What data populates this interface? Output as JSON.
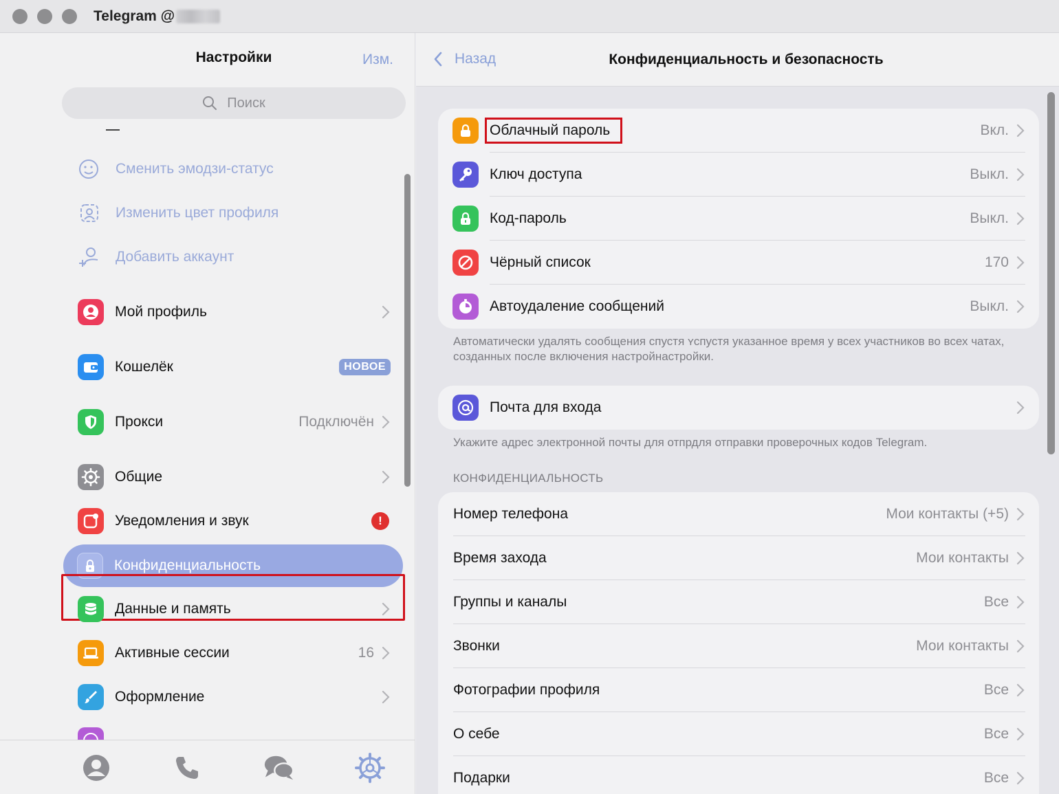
{
  "window": {
    "title": "Telegram @"
  },
  "left": {
    "title": "Настройки",
    "edit": "Изм.",
    "search_placeholder": "Поиск",
    "quick": [
      {
        "label": "Сменить эмодзи-статус",
        "icon": "emoji-status-icon"
      },
      {
        "label": "Изменить цвет профиля",
        "icon": "profile-color-icon"
      },
      {
        "label": "Добавить аккаунт",
        "icon": "add-account-icon"
      }
    ],
    "items": [
      {
        "label": "Мой профиль",
        "icon": "profile-icon",
        "color": "#ec3b5b"
      },
      {
        "label": "Кошелёк",
        "icon": "wallet-icon",
        "color": "#2a8ef0",
        "badge": "НОВОЕ"
      },
      {
        "label": "Прокси",
        "icon": "shield-icon",
        "color": "#35c35b",
        "value": "Подключён"
      },
      {
        "label": "Общие",
        "icon": "gear-icon",
        "color": "#8e8e93"
      },
      {
        "label": "Уведомления и звук",
        "icon": "bell-icon",
        "color": "#f04343",
        "alert": "!"
      },
      {
        "label": "Конфиденциальность",
        "icon": "lock-icon",
        "color": "#a9b7ea"
      },
      {
        "label": "Данные и память",
        "icon": "database-icon",
        "color": "#35c35b"
      },
      {
        "label": "Активные сессии",
        "icon": "laptop-icon",
        "color": "#f59a0c",
        "value": "16"
      },
      {
        "label": "Оформление",
        "icon": "brush-icon",
        "color": "#33a3e0"
      }
    ],
    "tabs": [
      "contacts-tab",
      "calls-tab",
      "chats-tab",
      "settings-tab"
    ]
  },
  "right": {
    "back": "Назад",
    "title": "Конфиденциальность и безопасность",
    "security": [
      {
        "label": "Облачный пароль",
        "value": "Вкл.",
        "icon": "cloud-lock-icon",
        "color": "#f59a0c"
      },
      {
        "label": "Ключ доступа",
        "value": "Выкл.",
        "icon": "key-icon",
        "color": "#5b58d9"
      },
      {
        "label": "Код-пароль",
        "value": "Выкл.",
        "icon": "passcode-lock-icon",
        "color": "#35c35b"
      },
      {
        "label": "Чёрный список",
        "value": "170",
        "icon": "blocked-icon",
        "color": "#f04343"
      },
      {
        "label": "Автоудаление сообщений",
        "value": "Выкл.",
        "icon": "timer-icon",
        "color": "#b35bd6"
      }
    ],
    "autodelete_note": "Автоматически удалять сообщения спустя ʏспустя указанное время у всех участников во всех чатах, созданных после включения настройнастройки.",
    "email": {
      "label": "Почта для входа",
      "icon": "at-icon",
      "color": "#5b58d9"
    },
    "email_note": "Укажите адрес электронной почты для отпрдля отправки проверочных кодов Telegram.",
    "privacy_header": "КОНФИДЕНЦИАЛЬНОСТЬ",
    "privacy": [
      {
        "label": "Номер телефона",
        "value": "Мои контакты (+5)"
      },
      {
        "label": "Время захода",
        "value": "Мои контакты"
      },
      {
        "label": "Группы и каналы",
        "value": "Все"
      },
      {
        "label": "Звонки",
        "value": "Мои контакты"
      },
      {
        "label": "Фотографии профиля",
        "value": "Все"
      },
      {
        "label": "О себе",
        "value": "Все"
      },
      {
        "label": "Подарки",
        "value": "Все"
      }
    ]
  }
}
